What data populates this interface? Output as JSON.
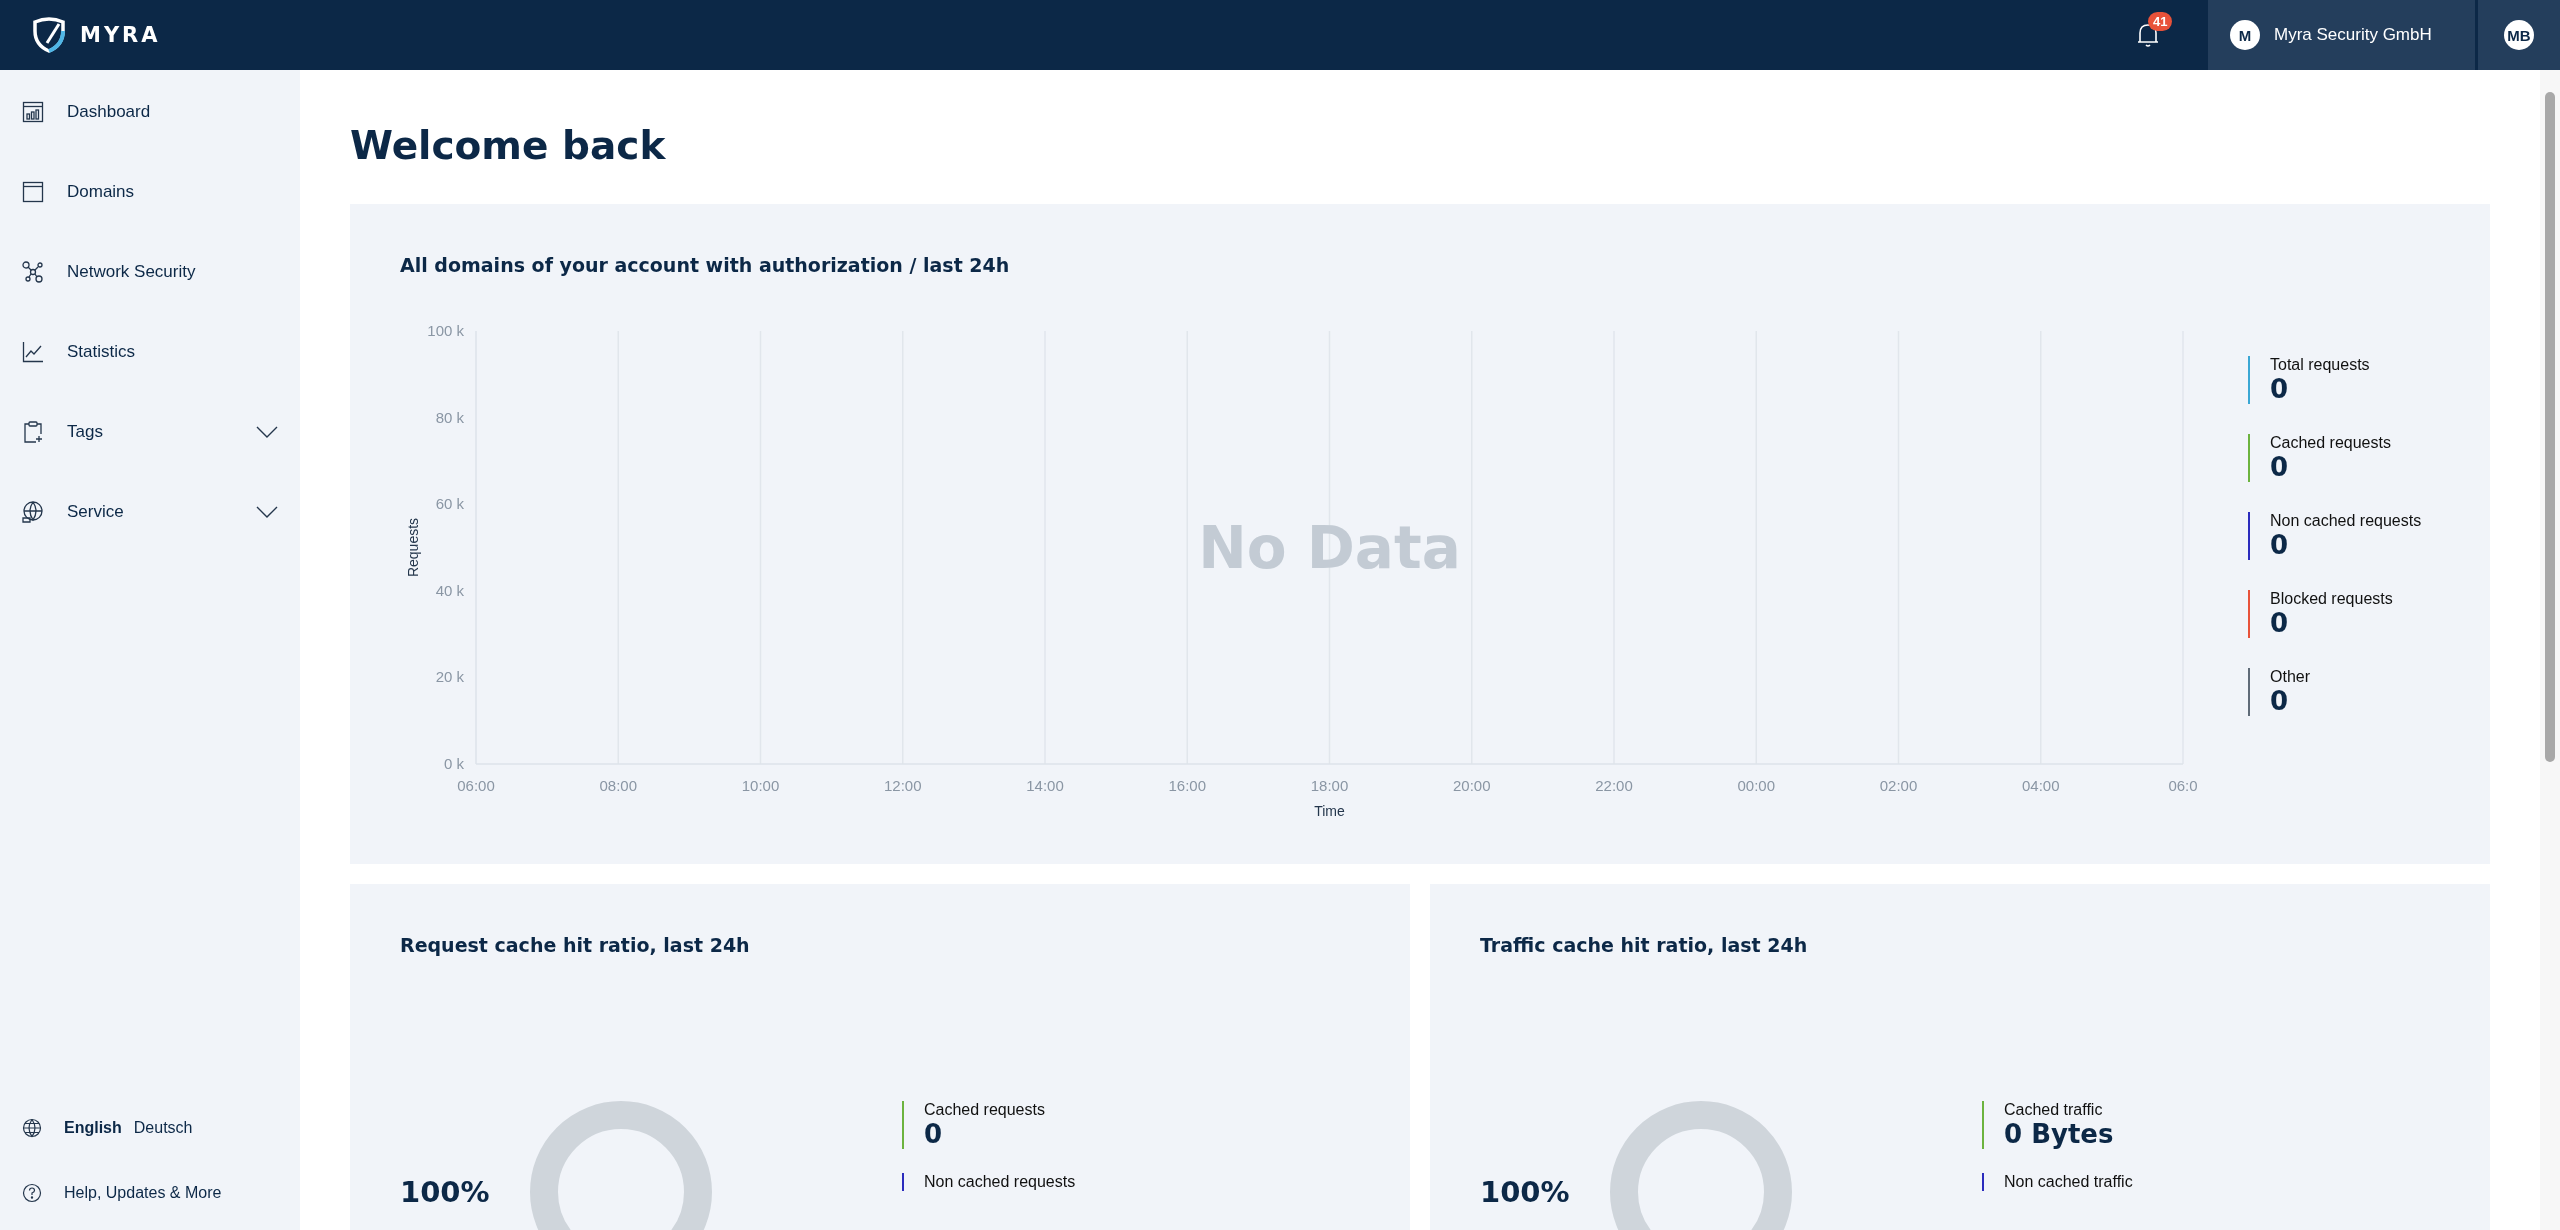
{
  "header": {
    "logo": "MYRA",
    "notifications": {
      "count": "41"
    },
    "organization": {
      "initial": "M",
      "name": "Myra Security GmbH"
    },
    "user": {
      "initials": "MB"
    }
  },
  "sidebar": {
    "items": [
      {
        "label": "Dashboard",
        "expandable": false
      },
      {
        "label": "Domains",
        "expandable": false
      },
      {
        "label": "Network Security",
        "expandable": false
      },
      {
        "label": "Statistics",
        "expandable": false
      },
      {
        "label": "Tags",
        "expandable": true,
        "expanded": false
      },
      {
        "label": "Service",
        "expandable": true,
        "expanded": false
      }
    ],
    "languages": [
      {
        "label": "English",
        "selected": true
      },
      {
        "label": "Deutsch",
        "selected": false
      }
    ],
    "help": "Help, Updates & More"
  },
  "page": {
    "title": "Welcome back"
  },
  "requests_card": {
    "title": "All domains of your account with authorization / last 24h",
    "chart_data": {
      "type": "line",
      "xlabel": "Time",
      "ylabel": "Requests",
      "categories": [
        "06:00",
        "08:00",
        "10:00",
        "12:00",
        "14:00",
        "16:00",
        "18:00",
        "20:00",
        "22:00",
        "00:00",
        "02:00",
        "04:00",
        "06:0"
      ],
      "ylim": [
        0,
        100000
      ],
      "grid": true,
      "yticks": [
        {
          "value": 0,
          "label": "0 k"
        },
        {
          "value": 20000,
          "label": "20 k"
        },
        {
          "value": 40000,
          "label": "40 k"
        },
        {
          "value": 60000,
          "label": "60 k"
        },
        {
          "value": 80000,
          "label": "80 k"
        },
        {
          "value": 100000,
          "label": "100 k"
        }
      ],
      "annotations": [
        "No Data"
      ]
    },
    "legend": [
      {
        "label": "Total requests",
        "value": "0",
        "color": "#3aa7d4"
      },
      {
        "label": "Cached requests",
        "value": "0",
        "color": "#6cb33f"
      },
      {
        "label": "Non cached requests",
        "value": "0",
        "color": "#2b2bbd"
      },
      {
        "label": "Blocked requests",
        "value": "0",
        "color": "#e8523a"
      },
      {
        "label": "Other",
        "value": "0",
        "color": "#5f6b78"
      }
    ]
  },
  "ratio_cards": [
    {
      "title": "Request cache hit ratio, last 24h",
      "percent": "100%",
      "legend": [
        {
          "label": "Cached requests",
          "value": "0",
          "color": "#6cb33f"
        },
        {
          "label": "Non cached requests",
          "color": "#2b2bbd"
        }
      ]
    },
    {
      "title": "Traffic cache hit ratio, last 24h",
      "percent": "100%",
      "legend": [
        {
          "label": "Cached traffic",
          "value": "0 Bytes",
          "color": "#6cb33f"
        },
        {
          "label": "Non cached traffic",
          "color": "#2b2bbd"
        }
      ]
    }
  ]
}
